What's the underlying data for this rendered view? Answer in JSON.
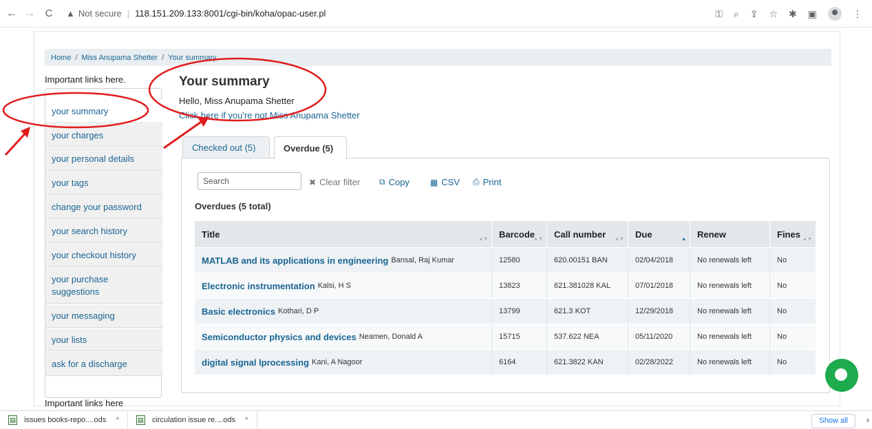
{
  "browser": {
    "security_label": "Not secure",
    "url": "118.151.209.133:8001/cgi-bin/koha/opac-user.pl"
  },
  "breadcrumb": {
    "home": "Home",
    "patron": "Miss Anupama Shetter",
    "current": "Your summary"
  },
  "sidebar": {
    "label": "Important links here.",
    "label_bottom": "Important links here",
    "items": [
      {
        "label": "your summary"
      },
      {
        "label": "your charges"
      },
      {
        "label": "your personal details"
      },
      {
        "label": "your tags"
      },
      {
        "label": "change your password"
      },
      {
        "label": "your search history"
      },
      {
        "label": "your checkout history"
      },
      {
        "label": "your purchase suggestions"
      },
      {
        "label": "your messaging"
      },
      {
        "label": "your lists"
      },
      {
        "label": "ask for a discharge"
      }
    ]
  },
  "main": {
    "title": "Your summary",
    "greeting": "Hello, Miss Anupama Shetter",
    "not_me_link": "Click here if you're not Miss Anupama Shetter",
    "tabs": [
      {
        "label": "Checked out (5)",
        "active": false
      },
      {
        "label": "Overdue (5)",
        "active": true
      }
    ],
    "toolbar": {
      "search_placeholder": "Search",
      "clear": "Clear filter",
      "copy": "Copy",
      "csv": "CSV",
      "print": "Print"
    },
    "section_title": "Overdues (5 total)",
    "table": {
      "headers": [
        "Title",
        "Barcode",
        "Call number",
        "Due",
        "Renew",
        "Fines"
      ],
      "rows": [
        {
          "title": "MATLAB and its applications in engineering",
          "author": "Bansal, Raj Kumar",
          "barcode": "12580",
          "call": "620.00151 BAN",
          "due": "02/04/2018",
          "renew": "No renewals left",
          "fines": "No"
        },
        {
          "title": "Electronic instrumentation",
          "author": "Kalsi, H S",
          "barcode": "13823",
          "call": "621.381028 KAL",
          "due": "07/01/2018",
          "renew": "No renewals left",
          "fines": "No"
        },
        {
          "title": "Basic electronics",
          "author": "Kothari, D P",
          "barcode": "13799",
          "call": "621.3 KOT",
          "due": "12/29/2018",
          "renew": "No renewals left",
          "fines": "No"
        },
        {
          "title": "Semiconductor physics and devices",
          "author": "Neamen, Donald A",
          "barcode": "15715",
          "call": "537.622 NEA",
          "due": "05/11/2020",
          "renew": "No renewals left",
          "fines": "No"
        },
        {
          "title": "digital signal lprocessing",
          "author": "Kani, A Nagoor",
          "barcode": "6164",
          "call": "621.3822 KAN",
          "due": "02/28/2022",
          "renew": "No renewals left",
          "fines": "No"
        }
      ]
    }
  },
  "downloads": {
    "items": [
      "issues books-repo....ods",
      "circulation issue re....ods"
    ],
    "show_all": "Show all"
  },
  "colors": {
    "link": "#1a6593",
    "annotation": "#e11b1b",
    "chat": "#1dab4d"
  }
}
